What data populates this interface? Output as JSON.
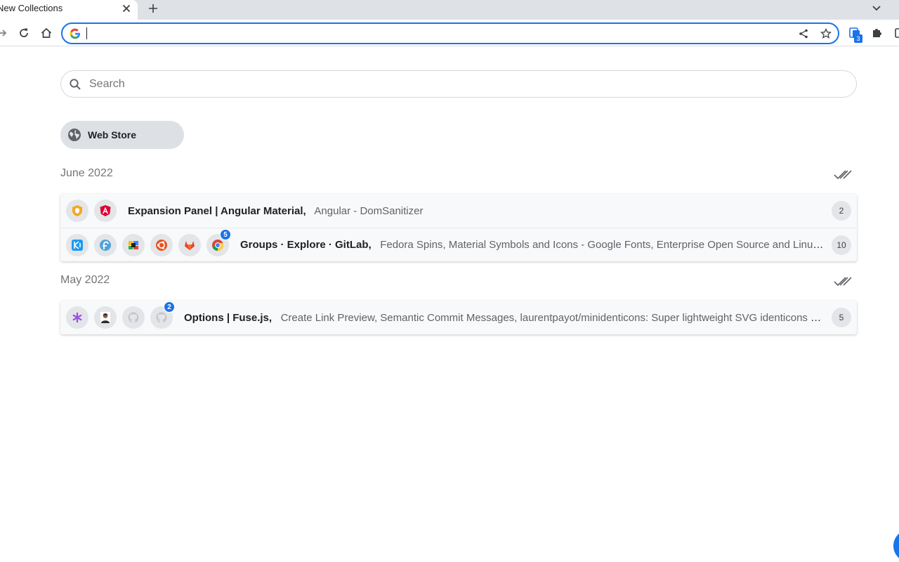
{
  "browser": {
    "tab_title": "New Collections",
    "address_value": "",
    "extension_badge": "3"
  },
  "search": {
    "placeholder": "Search"
  },
  "chip": {
    "label": "Web Store"
  },
  "groups": [
    {
      "title": "June 2022",
      "rows": [
        {
          "first": "Expansion Panel | Angular Material,",
          "rest": "Angular - DomSanitizer",
          "count": "2",
          "favicons": [
            "shield-icon",
            "angular-icon"
          ]
        },
        {
          "first": "Groups · Explore · GitLab,",
          "rest": "Fedora Spins,   Material Symbols and Icons - Google Fonts,   Enterprise Open Source and Linux | Ubuntu",
          "count": "10",
          "favicons": [
            "kde-icon",
            "fedora-icon",
            "colorful-grid-icon",
            "ubuntu-icon",
            "gitlab-icon",
            "chrome-icon"
          ],
          "badge": "5"
        }
      ]
    },
    {
      "title": "May 2022",
      "rows": [
        {
          "first": "Options | Fuse.js,",
          "rest": "Create Link Preview,   Semantic Commit Messages,   laurentpayot/minidenticons: Super lightweight SVG identicons generator",
          "count": "5",
          "favicons": [
            "asterisk-icon",
            "avatar-icon",
            "github-icon",
            "github-icon"
          ],
          "badge": "2"
        }
      ]
    }
  ],
  "colors": {
    "accent": "#1a73e8",
    "chip_bg": "#dde1e6",
    "card_bg": "#f8f9fa"
  }
}
